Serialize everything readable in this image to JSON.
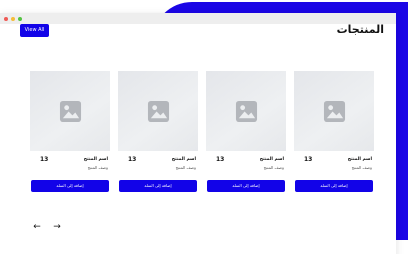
{
  "header": {
    "title": "المنتجات",
    "view_all_label": "View All"
  },
  "products": [
    {
      "name": "اسم المنتج",
      "description": "وصف المنتج",
      "price": "13",
      "button_label": "إضافة إلى السلة",
      "icon": "image-placeholder-icon"
    },
    {
      "name": "اسم المنتج",
      "description": "وصف المنتج",
      "price": "13",
      "button_label": "إضافة إلى السلة",
      "icon": "image-placeholder-icon"
    },
    {
      "name": "اسم المنتج",
      "description": "وصف المنتج",
      "price": "13",
      "button_label": "إضافة إلى السلة",
      "icon": "image-placeholder-icon"
    },
    {
      "name": "اسم المنتج",
      "description": "وصف المنتج",
      "price": "13",
      "button_label": "إضافة إلى السلة",
      "icon": "image-placeholder-icon"
    }
  ],
  "pagination": {
    "prev_icon": "arrow-left-icon",
    "next_icon": "arrow-right-icon",
    "prev_glyph": "←",
    "next_glyph": "→"
  },
  "colors": {
    "accent": "#1203e8",
    "decor_blue": "#1b06e6",
    "placeholder_bg": "#e8eaed"
  }
}
